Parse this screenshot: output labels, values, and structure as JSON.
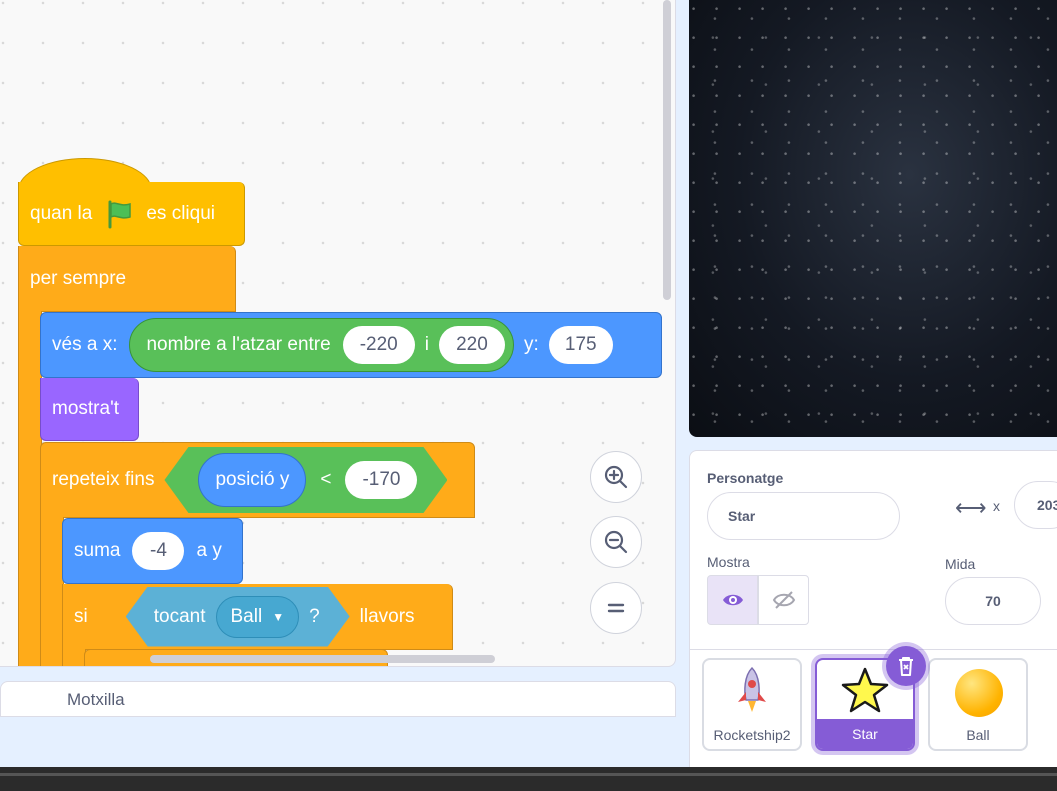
{
  "code": {
    "hat": {
      "before_flag": "quan la",
      "after_flag": "es cliqui"
    },
    "forever": {
      "label": "per sempre"
    },
    "goto": {
      "label": "vés a x:",
      "random_label": "nombre a l'atzar entre",
      "from": "-220",
      "and": "i",
      "to": "220",
      "y_label": "y:",
      "y_value": "175"
    },
    "show": {
      "label": "mostra't"
    },
    "repeat_until": {
      "label": "repeteix fins",
      "reporter": "posició y",
      "op": "<",
      "value": "-170"
    },
    "change_y": {
      "label": "suma",
      "value": "-4",
      "suffix": "a y"
    },
    "if_block": {
      "label": "si",
      "touching": "tocant",
      "target": "Ball",
      "question": "?",
      "then": "llavors"
    }
  },
  "backpack": {
    "label": "Motxilla"
  },
  "sprite_info": {
    "sprite_label": "Personatge",
    "sprite_name": "Star",
    "x_label": "x",
    "x_value": "203",
    "show_label": "Mostra",
    "size_label": "Mida",
    "size_value": "70"
  },
  "sprites": [
    {
      "name": "Rocketship2",
      "icon": "rocket-icon"
    },
    {
      "name": "Star",
      "icon": "star-icon",
      "selected": true
    },
    {
      "name": "Ball",
      "icon": "ball-icon"
    }
  ],
  "colors": {
    "events": "#ffbf00",
    "control": "#ffab19",
    "motion": "#4c97ff",
    "looks": "#9966ff",
    "operators": "#59c059",
    "sensing": "#5cb1d6",
    "accent": "#855cd6"
  }
}
